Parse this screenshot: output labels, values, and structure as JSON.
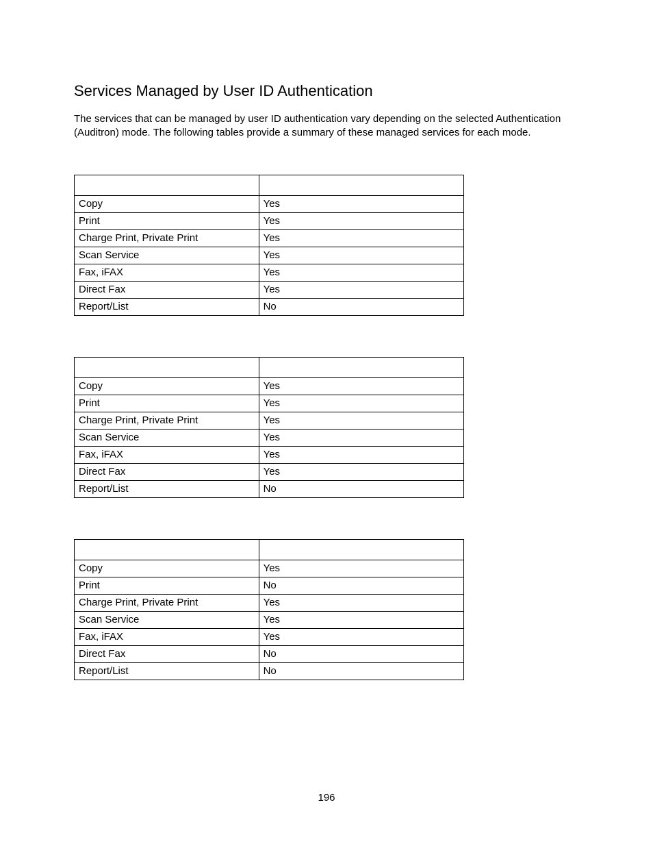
{
  "title": "Services Managed by User ID Authentication",
  "intro": "The services that can be managed by user ID authentication vary depending on the selected Authentication (Auditron) mode.  The following tables provide a summary of these managed services for each mode.",
  "tables": [
    {
      "header": {
        "col1": "",
        "col2": ""
      },
      "rows": [
        {
          "service": "Copy",
          "value": "Yes"
        },
        {
          "service": "Print",
          "value": "Yes"
        },
        {
          "service": "Charge Print, Private Print",
          "value": "Yes"
        },
        {
          "service": "Scan Service",
          "value": "Yes"
        },
        {
          "service": "Fax, iFAX",
          "value": "Yes"
        },
        {
          "service": "Direct Fax",
          "value": "Yes"
        },
        {
          "service": "Report/List",
          "value": "No"
        }
      ]
    },
    {
      "header": {
        "col1": "",
        "col2": ""
      },
      "rows": [
        {
          "service": "Copy",
          "value": "Yes"
        },
        {
          "service": "Print",
          "value": "Yes"
        },
        {
          "service": "Charge Print, Private Print",
          "value": "Yes"
        },
        {
          "service": "Scan Service",
          "value": "Yes"
        },
        {
          "service": "Fax, iFAX",
          "value": "Yes"
        },
        {
          "service": "Direct Fax",
          "value": "Yes"
        },
        {
          "service": "Report/List",
          "value": "No"
        }
      ]
    },
    {
      "header": {
        "col1": "",
        "col2": ""
      },
      "rows": [
        {
          "service": "Copy",
          "value": "Yes"
        },
        {
          "service": "Print",
          "value": "No"
        },
        {
          "service": "Charge Print, Private Print",
          "value": "Yes"
        },
        {
          "service": "Scan Service",
          "value": "Yes"
        },
        {
          "service": "Fax, iFAX",
          "value": "Yes"
        },
        {
          "service": "Direct Fax",
          "value": "No"
        },
        {
          "service": "Report/List",
          "value": "No"
        }
      ]
    }
  ],
  "pageNumber": "196"
}
